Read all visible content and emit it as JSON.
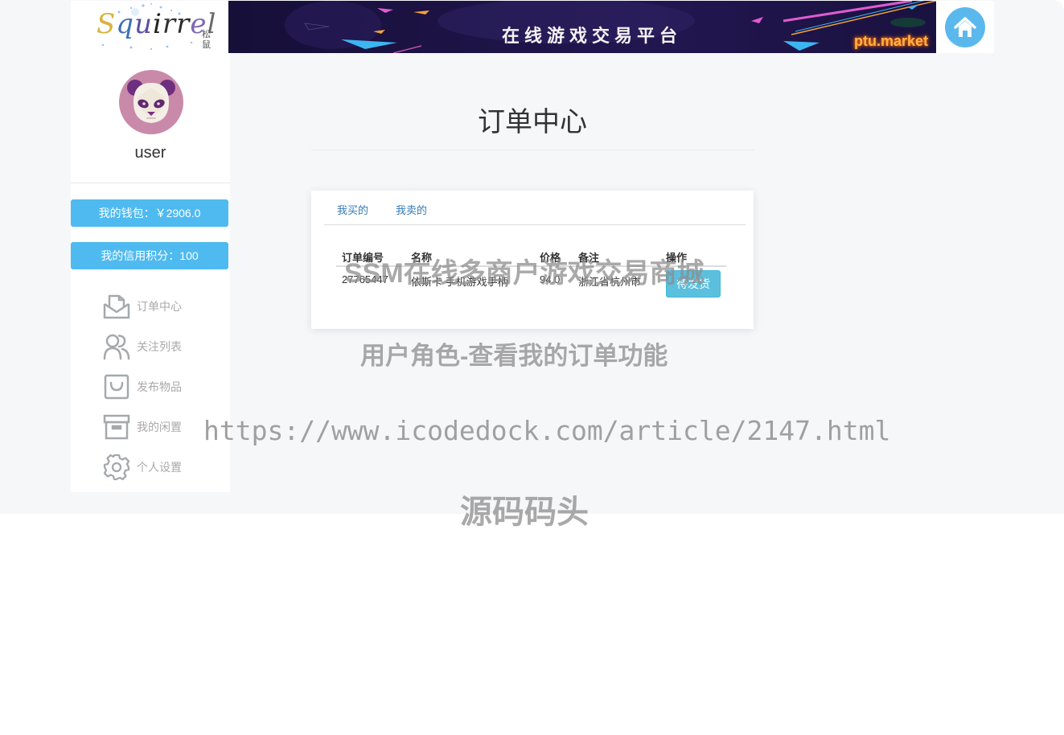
{
  "header": {
    "logo": {
      "wordmark": "Squirrel",
      "sub": "松鼠"
    },
    "banner": {
      "title": "在线游戏交易平台",
      "brand": "ptu.market"
    },
    "home_icon": "home-icon"
  },
  "sidebar": {
    "username": "user",
    "wallet_label": "我的钱包：￥2906.0",
    "credit_label": "我的信用积分：100",
    "menu": [
      {
        "label": "订单中心",
        "icon": "envelope-open-icon"
      },
      {
        "label": "关注列表",
        "icon": "users-icon"
      },
      {
        "label": "发布物品",
        "icon": "shopping-bag-icon"
      },
      {
        "label": "我的闲置",
        "icon": "archive-box-icon"
      },
      {
        "label": "个人设置",
        "icon": "gear-icon"
      }
    ]
  },
  "main": {
    "title": "订单中心",
    "tabs": [
      {
        "label": "我买的"
      },
      {
        "label": "我卖的"
      }
    ],
    "table": {
      "headers": [
        "订单编号",
        "名称",
        "价格",
        "备注",
        "操作"
      ],
      "rows": [
        {
          "id": "27765447",
          "name": "依斯卡 手机游戏手柄",
          "price": "94.0",
          "note": "浙江省杭州市",
          "action": "待发货"
        }
      ]
    }
  },
  "watermarks": {
    "line1": "SSM在线多商户游戏交易商城",
    "line2": "用户角色-查看我的订单功能",
    "line3": "https://www.icodedock.com/article/2147.html",
    "line4": "源码码头"
  },
  "colors": {
    "accent": "#4fbaf0",
    "link": "#337ab7",
    "action_button": "#5bc0de",
    "page_bg": "#f6f7f9"
  }
}
